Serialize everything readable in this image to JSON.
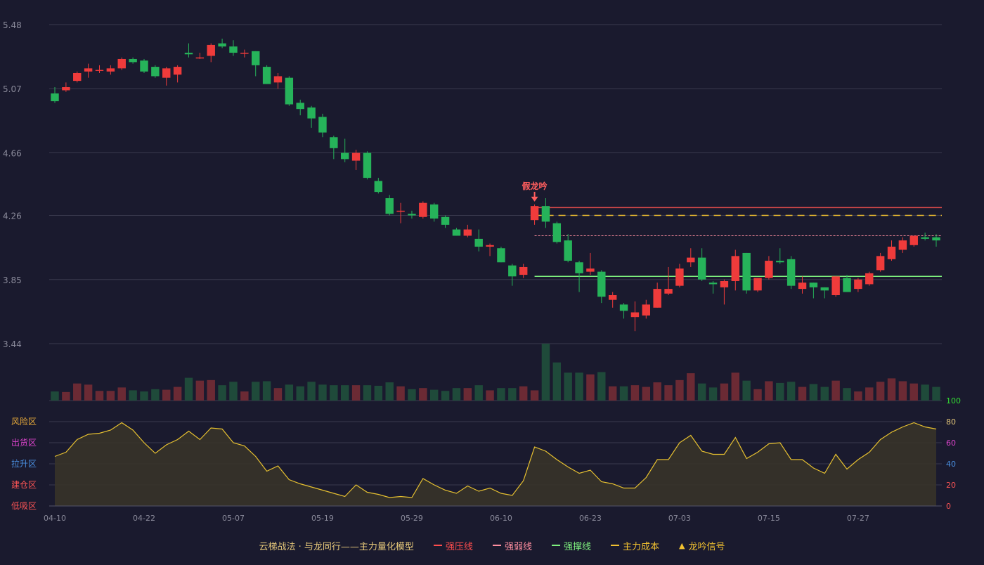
{
  "chart_data": {
    "type": "candlestick",
    "price_axis": {
      "ticks": [
        "5.48",
        "5.07",
        "4.66",
        "4.26",
        "3.85",
        "3.44"
      ],
      "min": 3.44,
      "max": 5.48
    },
    "x_labels": [
      "04-10",
      "04-22",
      "05-07",
      "05-19",
      "05-29",
      "06-10",
      "06-23",
      "07-03",
      "07-15",
      "07-27"
    ],
    "candles": [
      [
        5.04,
        4.99,
        5.08,
        4.98
      ],
      [
        5.06,
        5.08,
        5.11,
        5.05
      ],
      [
        5.12,
        5.17,
        5.18,
        5.11
      ],
      [
        5.18,
        5.2,
        5.23,
        5.14
      ],
      [
        5.19,
        5.19,
        5.22,
        5.17
      ],
      [
        5.18,
        5.2,
        5.22,
        5.16
      ],
      [
        5.2,
        5.26,
        5.27,
        5.19
      ],
      [
        5.26,
        5.24,
        5.27,
        5.23
      ],
      [
        5.25,
        5.18,
        5.26,
        5.17
      ],
      [
        5.21,
        5.15,
        5.22,
        5.14
      ],
      [
        5.14,
        5.2,
        5.21,
        5.09
      ],
      [
        5.16,
        5.21,
        5.22,
        5.11
      ],
      [
        5.3,
        5.29,
        5.36,
        5.27
      ],
      [
        5.27,
        5.27,
        5.3,
        5.26
      ],
      [
        5.28,
        5.35,
        5.36,
        5.24
      ],
      [
        5.36,
        5.34,
        5.39,
        5.33
      ],
      [
        5.34,
        5.3,
        5.38,
        5.28
      ],
      [
        5.3,
        5.3,
        5.32,
        5.27
      ],
      [
        5.31,
        5.22,
        5.31,
        5.15
      ],
      [
        5.21,
        5.1,
        5.22,
        5.1
      ],
      [
        5.11,
        5.15,
        5.17,
        5.07
      ],
      [
        5.14,
        4.97,
        5.15,
        4.96
      ],
      [
        4.98,
        4.94,
        5.0,
        4.9
      ],
      [
        4.95,
        4.88,
        4.96,
        4.82
      ],
      [
        4.89,
        4.79,
        4.91,
        4.76
      ],
      [
        4.76,
        4.69,
        4.77,
        4.62
      ],
      [
        4.66,
        4.62,
        4.75,
        4.6
      ],
      [
        4.61,
        4.66,
        4.68,
        4.55
      ],
      [
        4.66,
        4.5,
        4.67,
        4.49
      ],
      [
        4.48,
        4.41,
        4.5,
        4.4
      ],
      [
        4.37,
        4.27,
        4.39,
        4.26
      ],
      [
        4.29,
        4.29,
        4.34,
        4.21
      ],
      [
        4.27,
        4.26,
        4.29,
        4.24
      ],
      [
        4.25,
        4.34,
        4.35,
        4.24
      ],
      [
        4.33,
        4.24,
        4.34,
        4.22
      ],
      [
        4.25,
        4.2,
        4.26,
        4.18
      ],
      [
        4.17,
        4.13,
        4.18,
        4.13
      ],
      [
        4.13,
        4.17,
        4.2,
        4.12
      ],
      [
        4.11,
        4.06,
        4.17,
        4.03
      ],
      [
        4.06,
        4.07,
        4.08,
        4.0
      ],
      [
        4.05,
        3.96,
        4.06,
        3.96
      ],
      [
        3.94,
        3.87,
        3.95,
        3.81
      ],
      [
        3.88,
        3.93,
        3.95,
        3.86
      ],
      [
        4.23,
        4.32,
        4.33,
        4.2
      ],
      [
        4.32,
        4.22,
        4.37,
        4.18
      ],
      [
        4.21,
        4.09,
        4.22,
        4.08
      ],
      [
        4.1,
        3.97,
        4.14,
        3.96
      ],
      [
        3.96,
        3.89,
        3.97,
        3.77
      ],
      [
        3.9,
        3.92,
        4.02,
        3.88
      ],
      [
        3.9,
        3.74,
        3.91,
        3.7
      ],
      [
        3.72,
        3.75,
        3.77,
        3.67
      ],
      [
        3.69,
        3.65,
        3.7,
        3.6
      ],
      [
        3.61,
        3.64,
        3.71,
        3.52
      ],
      [
        3.62,
        3.69,
        3.72,
        3.6
      ],
      [
        3.67,
        3.79,
        3.83,
        3.67
      ],
      [
        3.76,
        3.79,
        3.93,
        3.75
      ],
      [
        3.81,
        3.92,
        3.95,
        3.8
      ],
      [
        3.96,
        3.99,
        4.05,
        3.93
      ],
      [
        3.99,
        3.85,
        4.05,
        3.84
      ],
      [
        3.83,
        3.82,
        3.84,
        3.76
      ],
      [
        3.8,
        3.84,
        3.85,
        3.69
      ],
      [
        3.84,
        4.0,
        4.04,
        3.78
      ],
      [
        4.02,
        3.78,
        4.02,
        3.76
      ],
      [
        3.78,
        3.86,
        3.86,
        3.77
      ],
      [
        3.86,
        3.97,
        4.0,
        3.85
      ],
      [
        3.97,
        3.96,
        4.05,
        3.95
      ],
      [
        3.98,
        3.81,
        4.0,
        3.79
      ],
      [
        3.79,
        3.83,
        3.87,
        3.76
      ],
      [
        3.83,
        3.8,
        3.83,
        3.73
      ],
      [
        3.8,
        3.78,
        3.8,
        3.73
      ],
      [
        3.75,
        3.87,
        3.87,
        3.74
      ],
      [
        3.86,
        3.77,
        3.88,
        3.77
      ],
      [
        3.79,
        3.85,
        3.86,
        3.77
      ],
      [
        3.82,
        3.89,
        3.9,
        3.81
      ],
      [
        3.91,
        4.0,
        4.02,
        3.9
      ],
      [
        3.98,
        4.06,
        4.1,
        3.97
      ],
      [
        4.04,
        4.1,
        4.12,
        4.02
      ],
      [
        4.07,
        4.13,
        4.13,
        4.06
      ],
      [
        4.12,
        4.11,
        4.15,
        4.1
      ],
      [
        4.12,
        4.1,
        4.14,
        4.06
      ]
    ],
    "volume": [
      16,
      15,
      30,
      28,
      17,
      17,
      23,
      18,
      16,
      20,
      19,
      24,
      40,
      35,
      36,
      27,
      33,
      16,
      33,
      34,
      22,
      28,
      25,
      33,
      28,
      27,
      27,
      27,
      27,
      26,
      32,
      25,
      20,
      22,
      19,
      17,
      22,
      22,
      27,
      18,
      22,
      22,
      25,
      18,
      100,
      67,
      49,
      49,
      46,
      50,
      25,
      25,
      27,
      24,
      32,
      27,
      36,
      48,
      30,
      23,
      30,
      49,
      35,
      20,
      34,
      31,
      33,
      24,
      29,
      24,
      35,
      22,
      16,
      23,
      33,
      39,
      34,
      30,
      28,
      24
    ],
    "indicator": [
      47,
      51,
      63,
      68,
      69,
      72,
      79,
      72,
      60,
      50,
      58,
      63,
      71,
      63,
      74,
      73,
      60,
      57,
      47,
      33,
      38,
      25,
      21,
      18,
      15,
      12,
      9,
      20,
      13,
      11,
      8,
      9,
      8,
      26,
      20,
      15,
      12,
      19,
      14,
      17,
      12,
      10,
      24,
      56,
      52,
      44,
      37,
      31,
      34,
      23,
      21,
      17,
      17,
      27,
      44,
      44,
      60,
      67,
      52,
      49,
      49,
      65,
      45,
      51,
      59,
      60,
      44,
      44,
      36,
      31,
      49,
      35,
      44,
      51,
      63,
      70,
      75,
      79,
      75,
      73
    ],
    "indicator_axis": {
      "ticks": [
        "100",
        "80",
        "60",
        "40",
        "20",
        "0"
      ],
      "colors": [
        "#33dd33",
        "#e6c87a",
        "#dd44cc",
        "#4a90e2",
        "#ff5555",
        "#ff5555"
      ]
    },
    "zone_labels": [
      {
        "text": "风险区",
        "color": "#e6a93a"
      },
      {
        "text": "出货区",
        "color": "#dd44cc"
      },
      {
        "text": "拉升区",
        "color": "#4a90e2"
      },
      {
        "text": "建仓区",
        "color": "#ff5555"
      },
      {
        "text": "低吸区",
        "color": "#ff5555"
      }
    ],
    "signal": {
      "label": "假龙吟",
      "index": 43,
      "color": "#ff5e5e"
    },
    "levels": [
      {
        "name": "强压线",
        "value": 4.31,
        "color": "#d94a4a",
        "style": "solid"
      },
      {
        "name": "主力成本",
        "value": 4.26,
        "color": "#f0c030",
        "style": "dash"
      },
      {
        "name": "强弱线",
        "value": 4.13,
        "color": "#ff8fa0",
        "style": "dot"
      },
      {
        "name": "强撑线",
        "value": 3.87,
        "color": "#7ef07e",
        "style": "solid"
      }
    ],
    "colors": {
      "up": "#ef3b3b",
      "down": "#26b35a",
      "grid": "#3a3a4e",
      "axis_text": "#8a8a9a",
      "indicator": "#e6c030"
    }
  },
  "legend": {
    "title": "云梯战法 · 与龙同行——主力量化模型",
    "items": [
      {
        "label": "强压线",
        "color": "#ff4d4d",
        "kind": "solid"
      },
      {
        "label": "强弱线",
        "color": "#ff8fa0",
        "kind": "dash"
      },
      {
        "label": "强撑线",
        "color": "#7ef07e",
        "kind": "solid"
      },
      {
        "label": "主力成本",
        "color": "#f0c030",
        "kind": "dash"
      },
      {
        "label": "龙吟信号",
        "color": "#f0c030",
        "kind": "tri"
      }
    ]
  }
}
